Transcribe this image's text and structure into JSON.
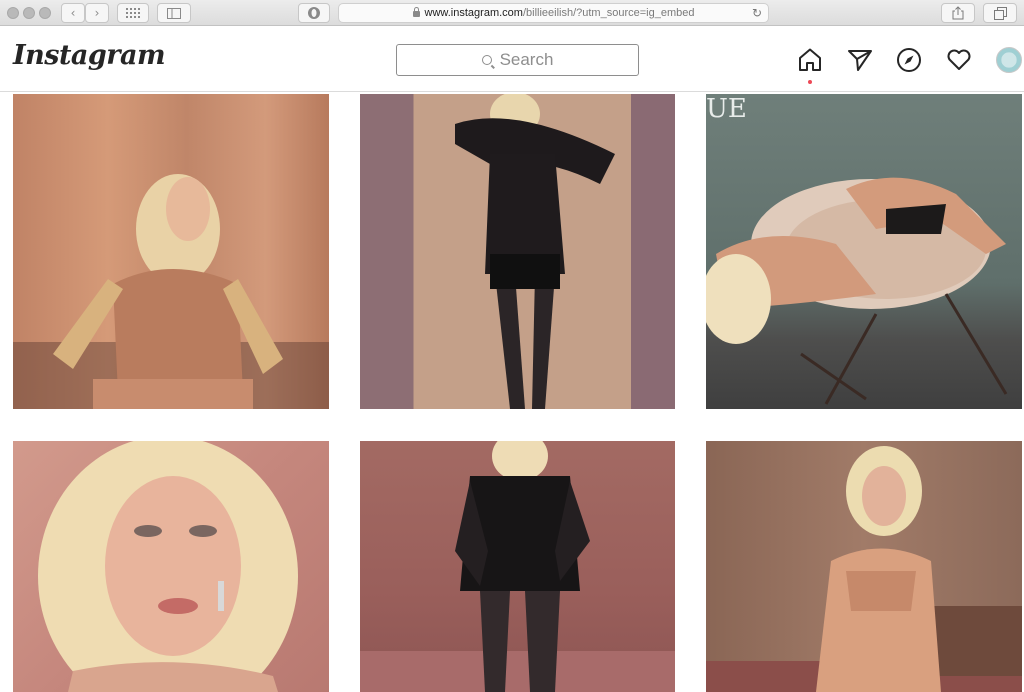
{
  "browser": {
    "nav_back_icon": "chevron-left-icon",
    "nav_forward_icon": "chevron-right-icon",
    "url_domain": "www.instagram.com",
    "url_path": "/billieeilish/?utm_source=ig_embed",
    "reload_icon": "reload-icon",
    "back_glyph": "‹",
    "forward_glyph": "›",
    "reload_glyph": "↻"
  },
  "header": {
    "logo_text": "Instagram",
    "search_placeholder": "Search",
    "nav_icons": [
      "home-icon",
      "direct-message-icon",
      "explore-icon",
      "activity-heart-icon"
    ],
    "notification_color": "#ed4956"
  },
  "grid": {
    "posts": [
      {
        "name": "post-1",
        "row": 1,
        "col": 1,
        "vogue_text": ""
      },
      {
        "name": "post-2",
        "row": 1,
        "col": 2,
        "vogue_text": ""
      },
      {
        "name": "post-3",
        "row": 1,
        "col": 3,
        "vogue_text": "UE"
      },
      {
        "name": "post-4",
        "row": 2,
        "col": 1,
        "vogue_text": ""
      },
      {
        "name": "post-5",
        "row": 2,
        "col": 2,
        "vogue_text": ""
      },
      {
        "name": "post-6",
        "row": 2,
        "col": 3,
        "vogue_text": ""
      }
    ]
  },
  "colors": {
    "accent": "#262626",
    "border": "#dbdbdb"
  }
}
